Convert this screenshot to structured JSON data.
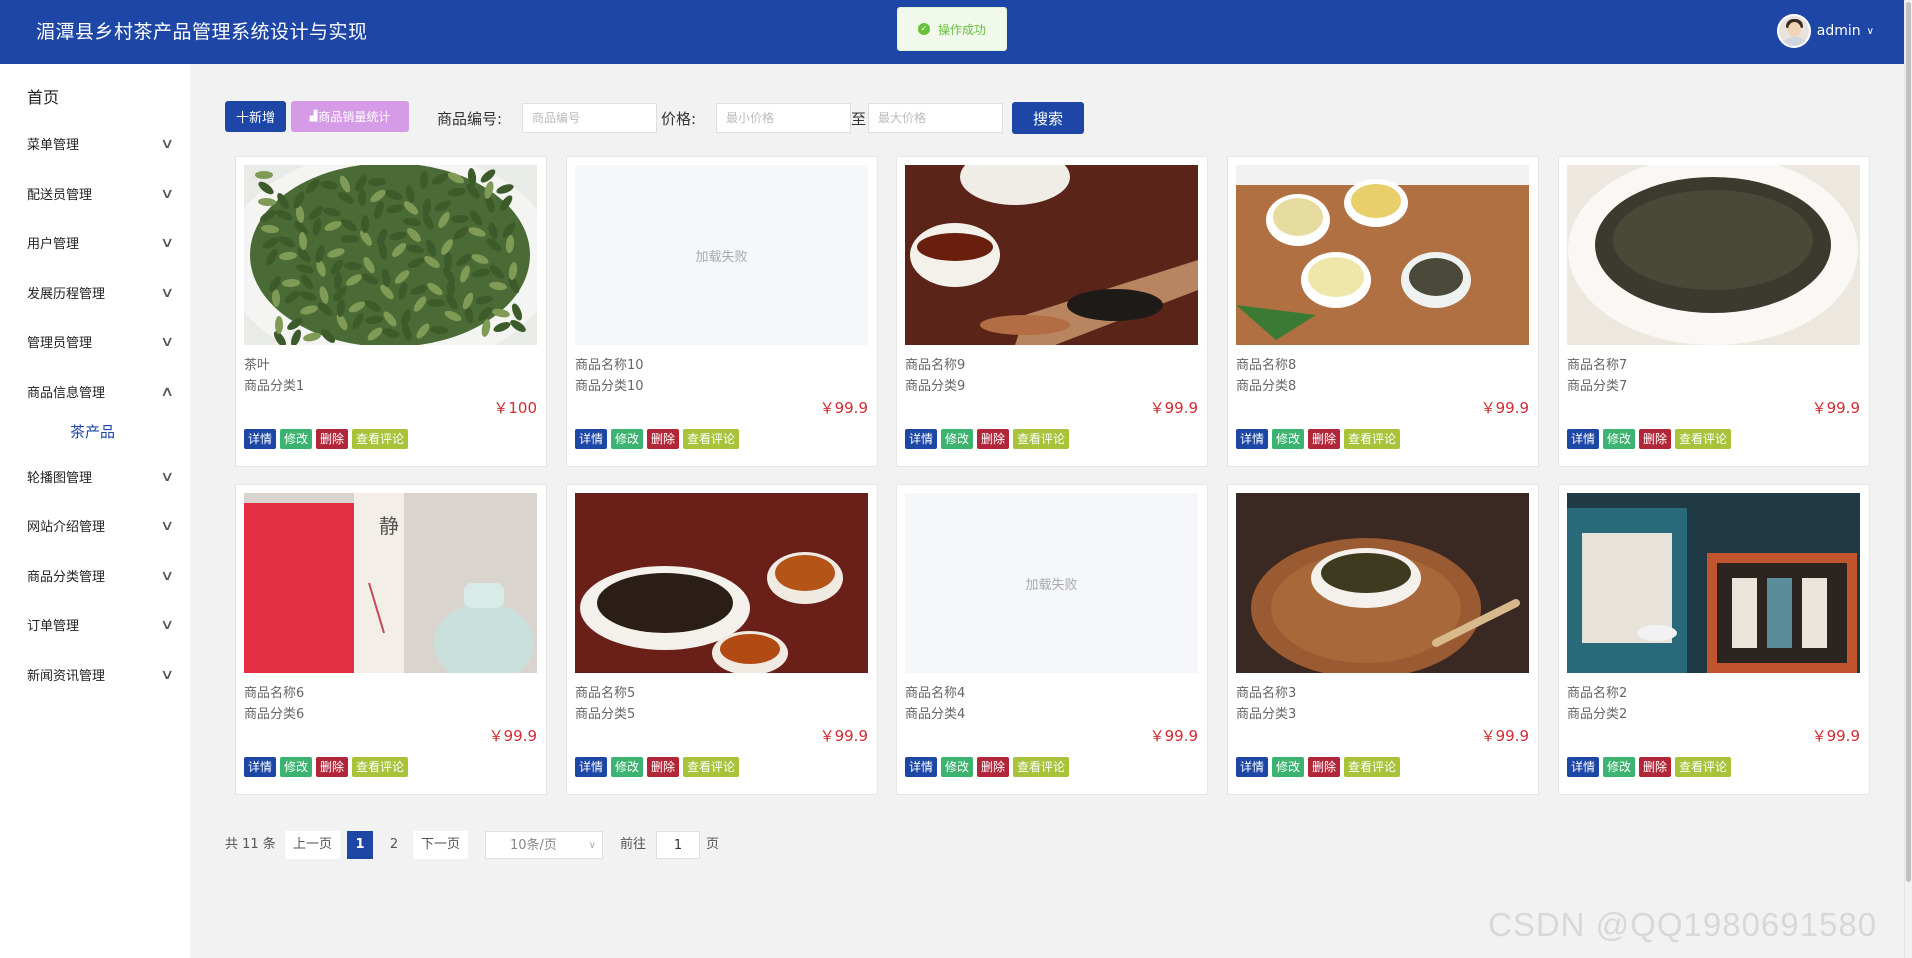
{
  "header": {
    "title": "湄潭县乡村茶产品管理系统设计与实现",
    "toast": "操作成功",
    "username": "admin"
  },
  "sidebar": {
    "home": "首页",
    "items": [
      {
        "label": "菜单管理",
        "expanded": false
      },
      {
        "label": "配送员管理",
        "expanded": false
      },
      {
        "label": "用户管理",
        "expanded": false
      },
      {
        "label": "发展历程管理",
        "expanded": false
      },
      {
        "label": "管理员管理",
        "expanded": false
      },
      {
        "label": "商品信息管理",
        "expanded": true
      },
      {
        "label": "轮播图管理",
        "expanded": false
      },
      {
        "label": "网站介绍管理",
        "expanded": false
      },
      {
        "label": "商品分类管理",
        "expanded": false
      },
      {
        "label": "订单管理",
        "expanded": false
      },
      {
        "label": "新闻资讯管理",
        "expanded": false
      }
    ],
    "sub_item": "茶产品"
  },
  "toolbar": {
    "add_label": "十新增",
    "stat_label": "商品销量统计",
    "code_label": "商品编号:",
    "code_placeholder": "商品编号",
    "price_label": "价格:",
    "min_placeholder": "最小价格",
    "to_label": "至",
    "max_placeholder": "最大价格",
    "search_label": "搜索"
  },
  "actions": {
    "detail": "详情",
    "edit": "修改",
    "delete": "删除",
    "review": "查看评论"
  },
  "image_failed_text": "加载失败",
  "products": [
    {
      "name": "茶叶",
      "category": "商品分类1",
      "price": "￥100",
      "image": "green-tea-leaves"
    },
    {
      "name": "商品名称10",
      "category": "商品分类10",
      "price": "￥99.9",
      "image": "failed"
    },
    {
      "name": "商品名称9",
      "category": "商品分类9",
      "price": "￥99.9",
      "image": "tea-cup-and-leaves"
    },
    {
      "name": "商品名称8",
      "category": "商品分类8",
      "price": "￥99.9",
      "image": "four-tea-cups"
    },
    {
      "name": "商品名称7",
      "category": "商品分类7",
      "price": "￥99.9",
      "image": "dark-tea-bowl"
    },
    {
      "name": "商品名称6",
      "category": "商品分类6",
      "price": "￥99.9",
      "image": "red-gift-box-and-jar"
    },
    {
      "name": "商品名称5",
      "category": "商品分类5",
      "price": "￥99.9",
      "image": "black-tea-bowl-and-cups"
    },
    {
      "name": "商品名称4",
      "category": "商品分类4",
      "price": "￥99.9",
      "image": "failed"
    },
    {
      "name": "商品名称3",
      "category": "商品分类3",
      "price": "￥99.9",
      "image": "tea-bowl-on-mat"
    },
    {
      "name": "商品名称2",
      "category": "商品分类2",
      "price": "￥99.9",
      "image": "tea-gift-set"
    }
  ],
  "pagination": {
    "total": "共 11 条",
    "prev": "上一页",
    "pages": [
      "1",
      "2"
    ],
    "current": "1",
    "next": "下一页",
    "page_size": "10条/页",
    "goto_label": "前往",
    "goto_value": "1",
    "page_suffix": "页"
  },
  "watermark": "CSDN @QQ1980691580"
}
